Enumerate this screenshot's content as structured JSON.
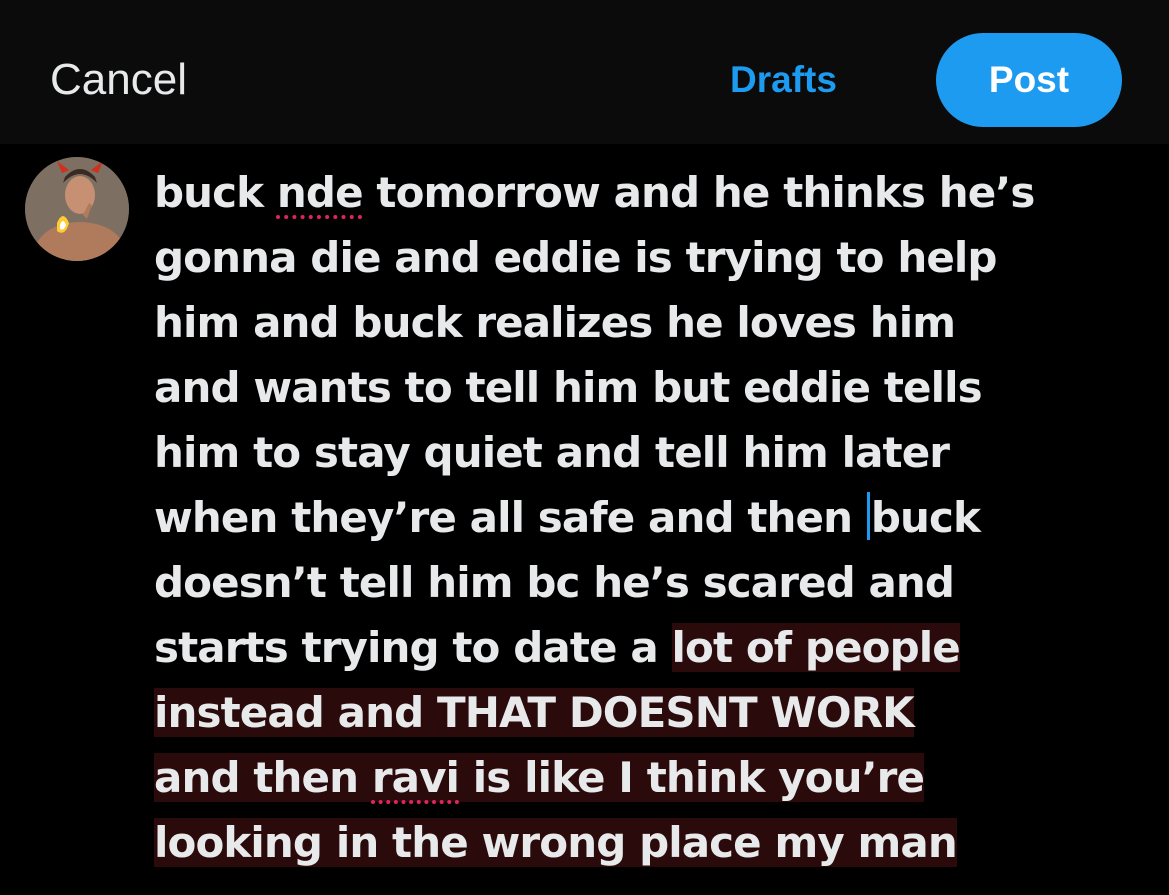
{
  "header": {
    "cancel_label": "Cancel",
    "drafts_label": "Drafts",
    "post_label": "Post"
  },
  "avatar": {
    "icon": "user-avatar"
  },
  "compose": {
    "lines": [
      {
        "a": "buck ",
        "b": "nde",
        "c": " tomorrow and he thinks he’s"
      },
      {
        "a": "gonna die and eddie is trying to help"
      },
      {
        "a": "him and buck realizes he loves him"
      },
      {
        "a": "and wants to tell him but eddie tells"
      },
      {
        "a": "him to stay quiet and tell him later"
      },
      {
        "a": "when they’re all safe and then ",
        "b": "buck"
      },
      {
        "a": "doesn’t tell him bc he’s scared and"
      },
      {
        "a": "starts trying to date a ",
        "b": "lot of people"
      },
      {
        "a": "instead and THAT DOESNT WORK"
      },
      {
        "a": "and then ",
        "b": "ravi",
        "c": " is like I think you’re"
      },
      {
        "a": "looking in the wrong place my man"
      }
    ]
  },
  "colors": {
    "accent": "#1d9bf0",
    "background": "#000000",
    "topbar": "#0b0b0b",
    "text": "#e7e9ea",
    "selection": "#2b0a0b",
    "spellcheck": "#e0245e"
  }
}
